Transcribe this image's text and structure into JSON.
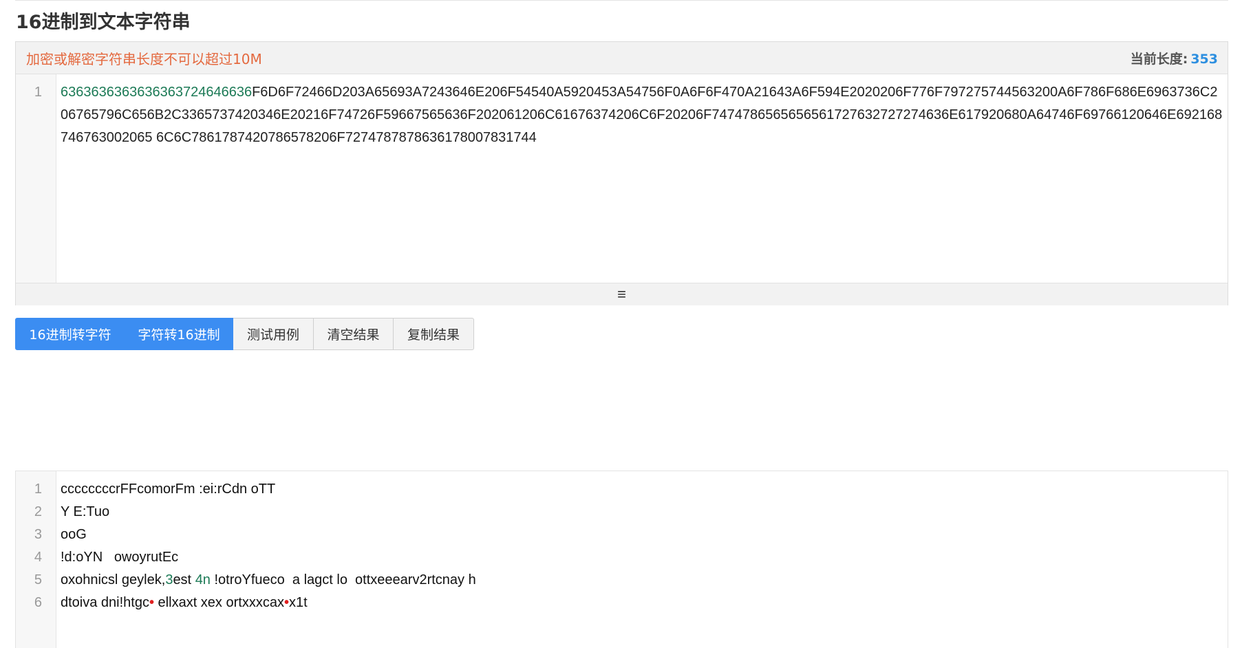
{
  "page": {
    "title": "16进制到文本字符串"
  },
  "input": {
    "warning": "加密或解密字符串长度不可以超过10M",
    "length_label": "当前长度:",
    "length_value": "353",
    "line_number": "1",
    "text_highlight": "63636363636363637246466 36",
    "text_highlight_clean": "6363636363636363724646636",
    "text_rest": "F6D6F72466D203A65693A7243646E206F54540A5920453A54756F0A6F6F470A21643A6F594E2020206F776F797275744563200A6F786F686E6963736C206765796C656B2C3365737420346E20216F74726F59667565636F202061206C61676374206C6F20206F74747865656565617276327274636E617920680A64746F69766120646E6921687467630020656C6C7861787420786578206F72747878786361780078317 44",
    "text_rest_clean": "F6D6F72466D203A65693A7243646E206F54540A5920453A54756F0A6F6F470A21643A6F594E2020206F776F797275744563200A6F786F686E6963736C206765796C656B2C3365737420346E20216F74726F59667565636F202061206C61676374206C6F20206F7474786565656561727632727274636E617920680A64746F69766120646E692168746763002065 6C6C7861787420786578206F7274787878636178007831744",
    "resize_glyph": "≡"
  },
  "buttons": {
    "hex_to_str": "16进制转字符",
    "str_to_hex": "字符转16进制",
    "test_case": "测试用例",
    "clear": "清空结果",
    "copy": "复制结果"
  },
  "output": {
    "line_numbers": [
      "1",
      "2",
      "3",
      "4",
      "5",
      "6"
    ],
    "lines": [
      {
        "segments": [
          {
            "t": "ccccccccrFFcomorFm :ei:rCdn oTT",
            "s": "n"
          }
        ]
      },
      {
        "segments": [
          {
            "t": "Y E:Tuo",
            "s": "n"
          }
        ]
      },
      {
        "segments": [
          {
            "t": "ooG",
            "s": "n"
          }
        ]
      },
      {
        "segments": [
          {
            "t": "!d:oYN   owoyrutEc",
            "s": "n"
          }
        ]
      },
      {
        "segments": [
          {
            "t": "oxohnicsl geylek,",
            "s": "n"
          },
          {
            "t": "3",
            "s": "g"
          },
          {
            "t": "est ",
            "s": "n"
          },
          {
            "t": "4n",
            "s": "g"
          },
          {
            "t": " !otroYfueco  a lagct lo  ottxeeearv2rtcnay h",
            "s": "n"
          }
        ]
      },
      {
        "segments": [
          {
            "t": "dtoiva dni!htgc",
            "s": "n"
          },
          {
            "t": "•",
            "s": "d"
          },
          {
            "t": " ellxaxt xex ortxxxcax",
            "s": "n"
          },
          {
            "t": "•",
            "s": "d"
          },
          {
            "t": "x1t",
            "s": "n"
          }
        ]
      }
    ]
  }
}
